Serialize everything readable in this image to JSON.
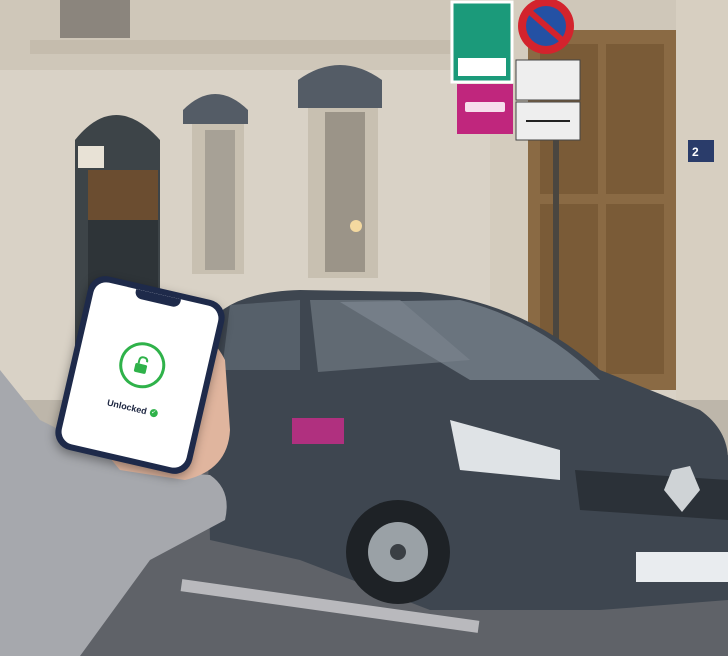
{
  "photo": {
    "subject": "hand-holding-phone-unlocking-car",
    "colors": {
      "accent": "#2fb24a",
      "brand_sign": "#c0267d",
      "parking_sign": "#1b9a7a"
    }
  },
  "phone": {
    "status_text": "Unlocked",
    "icon": "unlocked-padlock-icon"
  }
}
